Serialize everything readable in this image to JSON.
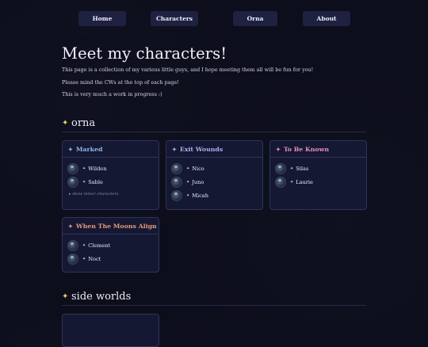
{
  "nav": {
    "items": [
      "Home",
      "Characters",
      "Orna",
      "About"
    ]
  },
  "page": {
    "title": "Meet my characters!",
    "paragraphs": [
      "This page is a collection of my various little guys, and I hope meeting them all will be fun for you!",
      "Please mind the CWs at the top of each page!",
      "This is very much a work in progress :)"
    ]
  },
  "sections": [
    {
      "title": "orna",
      "cards": [
        {
          "title": "Marked",
          "color": "#8fb6ea",
          "characters": [
            "Wilden",
            "Sable"
          ],
          "extra": "show minor characters"
        },
        {
          "title": "Exit Wounds",
          "color": "#b9a7ea",
          "characters": [
            "Nico",
            "Juno",
            "Micah"
          ]
        },
        {
          "title": "To Be Known",
          "color": "#e58fbf",
          "characters": [
            "Silas",
            "Laurie"
          ]
        },
        {
          "title": "When The Moons Align",
          "color": "#e49a78",
          "characters": [
            "Clement",
            "Noct"
          ]
        }
      ]
    },
    {
      "title": "side worlds"
    }
  ],
  "colors": {
    "background": "#0d0e1b",
    "card": "#151833",
    "nav": "#1e2140",
    "sparkle": "#e7c86a"
  },
  "icons": {
    "sparkle": "sparkle-icon",
    "avatar": "character-avatar-icon"
  }
}
